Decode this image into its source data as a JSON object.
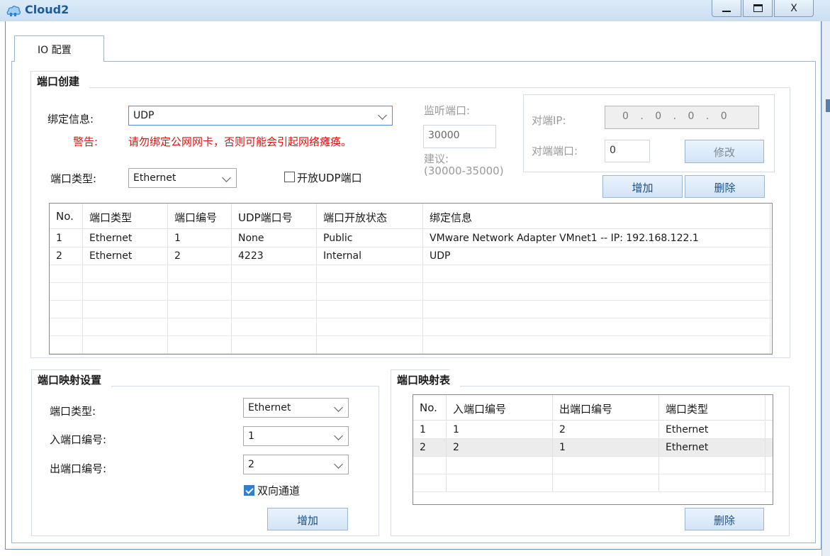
{
  "window": {
    "title": "Cloud2",
    "close_glyph": "X"
  },
  "tabs": [
    {
      "label": "IO 配置"
    }
  ],
  "port_creation": {
    "title": "端口创建",
    "bind_label": "绑定信息:",
    "bind_value": "UDP",
    "warning_label": "警告:",
    "warning_text": "请勿绑定公网网卡，否则可能会引起网络瘫痪。",
    "port_type_label": "端口类型:",
    "port_type_value": "Ethernet",
    "open_udp_label": "开放UDP端口",
    "open_udp_checked": false,
    "listen_port_label": "监听端口:",
    "listen_port_value": "30000",
    "suggestion_label": "建议:",
    "suggestion_range": "(30000-35000)",
    "remote_ip_label": "对端IP:",
    "remote_ip_value": "0 . 0 . 0 . 0",
    "remote_port_label": "对端端口:",
    "remote_port_value": "0",
    "modify_button": "修改",
    "add_button": "增加",
    "delete_button": "删除"
  },
  "ports_table": {
    "headers": [
      "No.",
      "端口类型",
      "端口编号",
      "UDP端口号",
      "端口开放状态",
      "绑定信息"
    ],
    "rows": [
      [
        "1",
        "Ethernet",
        "1",
        "None",
        "Public",
        "VMware Network Adapter VMnet1 -- IP: 192.168.122.1"
      ],
      [
        "2",
        "Ethernet",
        "2",
        "4223",
        "Internal",
        "UDP"
      ]
    ]
  },
  "mapping_settings": {
    "title": "端口映射设置",
    "port_type_label": "端口类型:",
    "port_type_value": "Ethernet",
    "in_port_label": "入端口编号:",
    "in_port_value": "1",
    "out_port_label": "出端口编号:",
    "out_port_value": "2",
    "bidirectional_label": "双向通道",
    "bidirectional_checked": true,
    "add_button": "增加"
  },
  "mapping_table": {
    "title": "端口映射表",
    "headers": [
      "No.",
      "入端口编号",
      "出端口编号",
      "端口类型"
    ],
    "rows": [
      [
        "1",
        "1",
        "2",
        "Ethernet"
      ],
      [
        "2",
        "2",
        "1",
        "Ethernet"
      ]
    ],
    "selected_row": 1,
    "delete_button": "删除"
  },
  "colors": {
    "warning": "#e01010",
    "title_blue": "#1f5a96",
    "checkbox_blue": "#2f7fd1"
  }
}
